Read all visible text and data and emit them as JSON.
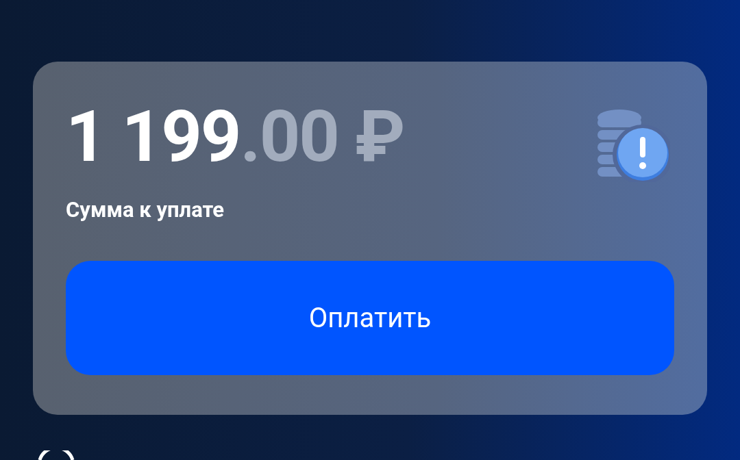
{
  "payment_card": {
    "amount_integer": "1 199",
    "amount_fraction": ".00",
    "currency": "₽",
    "label": "Сумма к уплате",
    "pay_button": "Оплатить"
  }
}
